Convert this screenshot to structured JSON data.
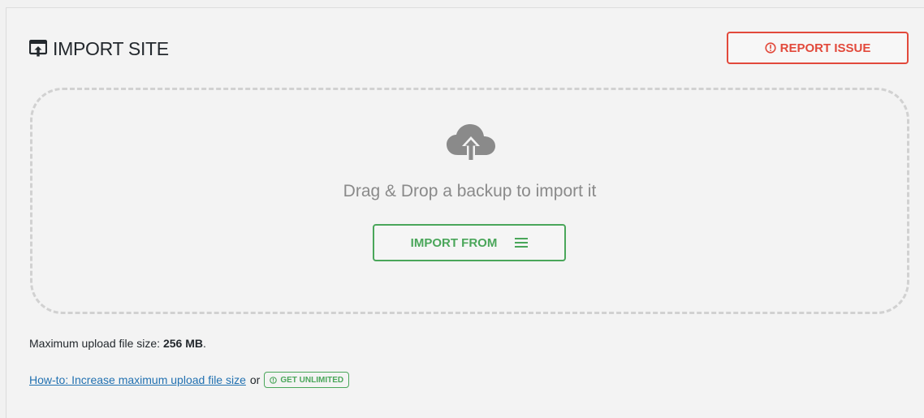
{
  "header": {
    "title": "IMPORT SITE",
    "icon": "import-box-icon"
  },
  "report_button": {
    "label": "REPORT ISSUE",
    "icon": "alert-circle-icon",
    "color": "#e2493b"
  },
  "dropzone": {
    "icon": "cloud-upload-icon",
    "text": "Drag & Drop a backup to import it",
    "import_button": {
      "label": "IMPORT FROM",
      "icon": "menu-icon",
      "color": "#4aa65a"
    }
  },
  "footer": {
    "max_size_label": "Maximum upload file size:",
    "max_size_value": "256 MB",
    "max_size_suffix": ".",
    "howto_link": "How-to: Increase maximum upload file size",
    "or_text": "or",
    "unlimited_label": "GET UNLIMITED"
  }
}
